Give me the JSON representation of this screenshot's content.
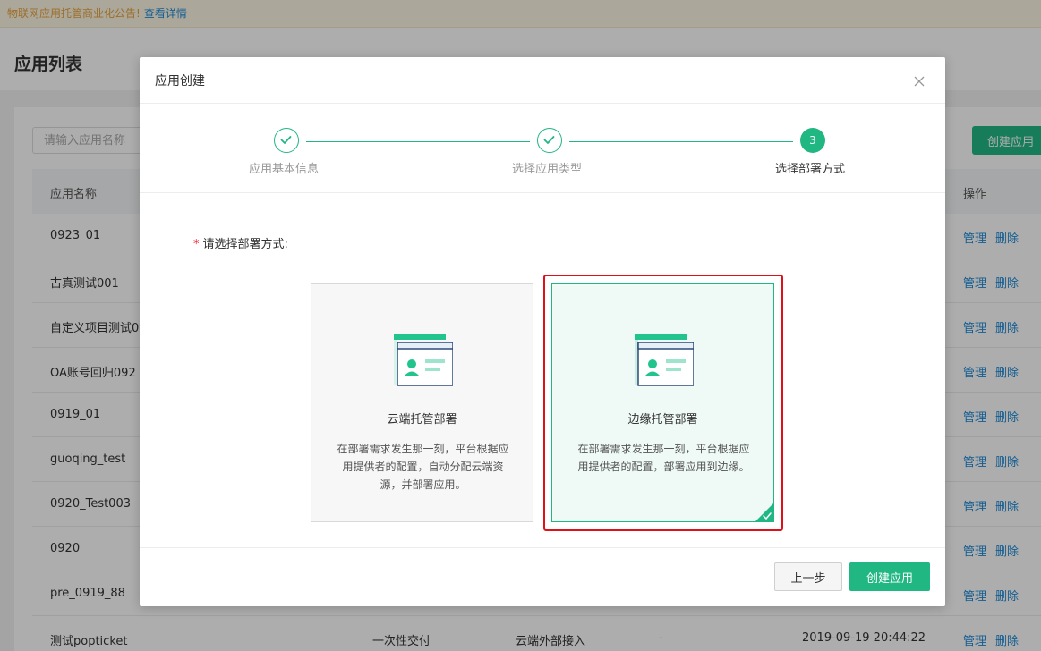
{
  "notice": {
    "text": "物联网应用托管商业化公告!",
    "link": "查看详情"
  },
  "page": {
    "title": "应用列表",
    "search_placeholder": "请输入应用名称",
    "create_button": "创建应用",
    "table": {
      "header_name": "应用名称",
      "header_ops": "操作",
      "op_manage": "管理",
      "op_delete": "删除",
      "rows": [
        {
          "name": "0923_01"
        },
        {
          "name": "古真测试001"
        },
        {
          "name": "自定义项目测试0"
        },
        {
          "name": "OA账号回归092"
        },
        {
          "name": "0919_01"
        },
        {
          "name": "guoqing_test"
        },
        {
          "name": "0920_Test003"
        },
        {
          "name": "0920"
        },
        {
          "name": "pre_0919_88"
        },
        {
          "name": "测试popticket",
          "delivery": "一次性交付",
          "access": "云端外部接入",
          "extra": "-",
          "time": "2019-09-19 20:44:22"
        }
      ]
    }
  },
  "modal": {
    "title": "应用创建",
    "steps": [
      {
        "label": "应用基本信息",
        "status": "done"
      },
      {
        "label": "选择应用类型",
        "status": "done"
      },
      {
        "label": "选择部署方式",
        "status": "active",
        "number": "3"
      }
    ],
    "form_label": "请选择部署方式:",
    "required_mark": "*",
    "options": [
      {
        "title": "云端托管部署",
        "desc": "在部署需求发生那一刻，平台根据应用提供者的配置，自动分配云端资源，并部署应用。",
        "selected": false
      },
      {
        "title": "边缘托管部署",
        "desc": "在部署需求发生那一刻，平台根据应用提供者的配置，部署应用到边缘。",
        "selected": true
      }
    ],
    "prev_button": "上一步",
    "create_button": "创建应用"
  },
  "colors": {
    "accent": "#21b783",
    "link": "#1e8ad6",
    "highlight": "#e0101a"
  }
}
